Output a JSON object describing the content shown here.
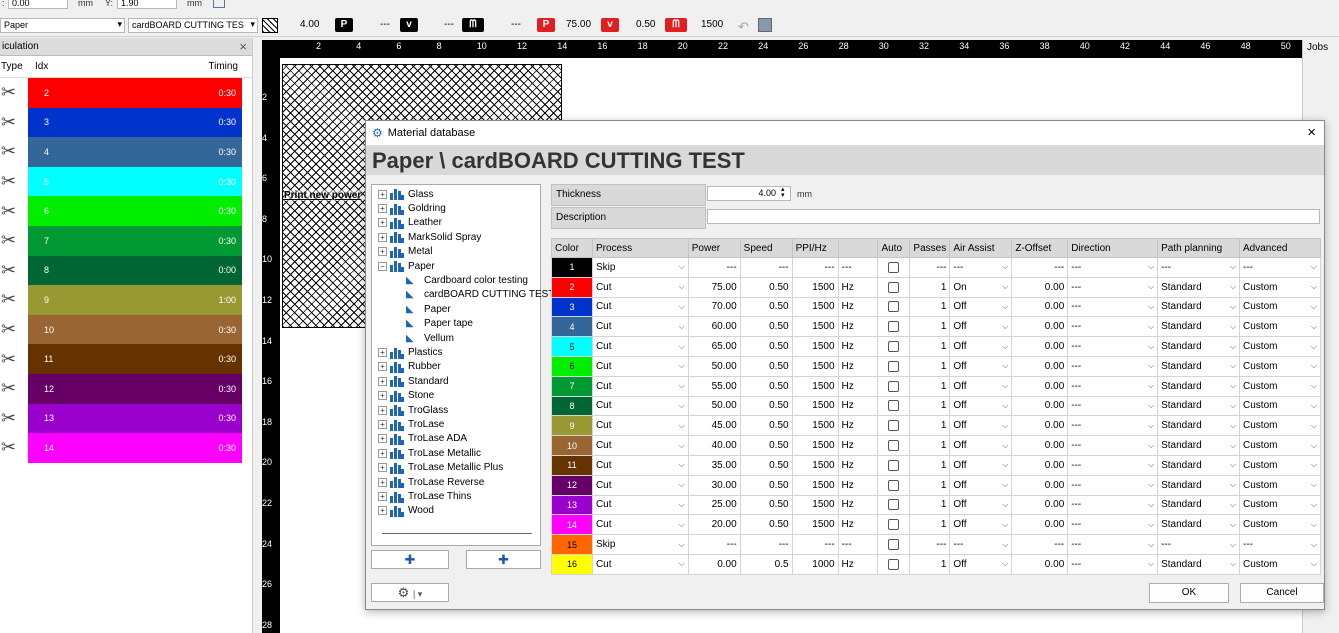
{
  "toolbar_top": {
    "x_value": "0.00",
    "x_unit": "mm",
    "y_label": "Y:",
    "y_value": "1.90",
    "y_unit": "mm"
  },
  "toolbar": {
    "material_group": "Paper",
    "material_name": "cardBOARD CUTTING TES",
    "thickness": "4.00",
    "p_label": "P",
    "p_value": "---",
    "v_label": "v",
    "v_value": "---",
    "hz_value": "---",
    "active_power": "75.00",
    "active_speed": "0.50",
    "active_freq": "1500"
  },
  "left_panel": {
    "title": "iculation",
    "close": "×",
    "col_type": "Type",
    "col_idx": "Idx",
    "col_timing": "Timing",
    "rows": [
      {
        "idx": "2",
        "timing": "0:30",
        "color": "#ff0000"
      },
      {
        "idx": "3",
        "timing": "0:30",
        "color": "#0033cc"
      },
      {
        "idx": "4",
        "timing": "0:30",
        "color": "#336699"
      },
      {
        "idx": "5",
        "timing": "0:30",
        "color": "#00ffff"
      },
      {
        "idx": "6",
        "timing": "0:30",
        "color": "#00ee00"
      },
      {
        "idx": "7",
        "timing": "0:30",
        "color": "#009933"
      },
      {
        "idx": "8",
        "timing": "0:00",
        "color": "#006633"
      },
      {
        "idx": "9",
        "timing": "1:00",
        "color": "#999933"
      },
      {
        "idx": "10",
        "timing": "0:30",
        "color": "#996633"
      },
      {
        "idx": "11",
        "timing": "0:30",
        "color": "#663300"
      },
      {
        "idx": "12",
        "timing": "0:30",
        "color": "#660066"
      },
      {
        "idx": "13",
        "timing": "0:30",
        "color": "#9900cc"
      },
      {
        "idx": "14",
        "timing": "0:30",
        "color": "#ff00ff"
      }
    ]
  },
  "ruler": {
    "top": [
      "2",
      "4",
      "6",
      "8",
      "10",
      "12",
      "14",
      "16",
      "18",
      "20",
      "22",
      "24",
      "26",
      "28",
      "30",
      "32",
      "34",
      "36",
      "38",
      "40",
      "42",
      "44",
      "46",
      "48",
      "50"
    ],
    "left": [
      "2",
      "4",
      "6",
      "8",
      "10",
      "12",
      "14",
      "16",
      "18",
      "20",
      "22",
      "24",
      "26",
      "28"
    ]
  },
  "canvas": {
    "overlay_text": "Print new power"
  },
  "jobs_tab": "Jobs",
  "dialog": {
    "title": "Material database",
    "heading": "Paper \\ cardBOARD CUTTING TEST",
    "close": "×",
    "tree": [
      {
        "label": "Glass",
        "level": 0,
        "expander": "+"
      },
      {
        "label": "Goldring",
        "level": 0,
        "expander": "+"
      },
      {
        "label": "Leather",
        "level": 0,
        "expander": "+"
      },
      {
        "label": "MarkSolid Spray",
        "level": 0,
        "expander": "+"
      },
      {
        "label": "Metal",
        "level": 0,
        "expander": "+"
      },
      {
        "label": "Paper",
        "level": 0,
        "expander": "−"
      },
      {
        "label": "Cardboard color testing",
        "level": 1
      },
      {
        "label": "cardBOARD CUTTING TEST",
        "level": 1
      },
      {
        "label": "Paper",
        "level": 1
      },
      {
        "label": "Paper tape",
        "level": 1
      },
      {
        "label": "Vellum",
        "level": 1
      },
      {
        "label": "Plastics",
        "level": 0,
        "expander": "+"
      },
      {
        "label": "Rubber",
        "level": 0,
        "expander": "+"
      },
      {
        "label": "Standard",
        "level": 0,
        "expander": "+"
      },
      {
        "label": "Stone",
        "level": 0,
        "expander": "+"
      },
      {
        "label": "TroGlass",
        "level": 0,
        "expander": "+"
      },
      {
        "label": "TroLase",
        "level": 0,
        "expander": "+"
      },
      {
        "label": "TroLase ADA",
        "level": 0,
        "expander": "+"
      },
      {
        "label": "TroLase Metallic",
        "level": 0,
        "expander": "+"
      },
      {
        "label": "TroLase Metallic Plus",
        "level": 0,
        "expander": "+"
      },
      {
        "label": "TroLase Reverse",
        "level": 0,
        "expander": "+"
      },
      {
        "label": "TroLase Thins",
        "level": 0,
        "expander": "+"
      },
      {
        "label": "Wood",
        "level": 0,
        "expander": "+"
      }
    ],
    "thickness_label": "Thickness",
    "thickness_value": "4.00",
    "thickness_unit": "mm",
    "description_label": "Description",
    "description_value": "",
    "columns": [
      "Color",
      "Process",
      "Power",
      "Speed",
      "PPI/Hz",
      "",
      "Auto",
      "Passes",
      "Air Assist",
      "Z-Offset",
      "Direction",
      "Path planning",
      "Advanced"
    ],
    "rows": [
      {
        "idx": "1",
        "color": "#000000",
        "process": "Skip",
        "power": "---",
        "speed": "---",
        "ppi": "---",
        "unit": "---",
        "passes": "---",
        "air": "---",
        "z": "---",
        "dir": "---",
        "path": "---",
        "adv": "---"
      },
      {
        "idx": "2",
        "color": "#ff0000",
        "process": "Cut",
        "power": "75.00",
        "speed": "0.50",
        "ppi": "1500",
        "unit": "Hz",
        "passes": "1",
        "air": "On",
        "z": "0.00",
        "dir": "---",
        "path": "Standard",
        "adv": "Custom"
      },
      {
        "idx": "3",
        "color": "#0033cc",
        "process": "Cut",
        "power": "70.00",
        "speed": "0.50",
        "ppi": "1500",
        "unit": "Hz",
        "passes": "1",
        "air": "Off",
        "z": "0.00",
        "dir": "---",
        "path": "Standard",
        "adv": "Custom"
      },
      {
        "idx": "4",
        "color": "#336699",
        "process": "Cut",
        "power": "60.00",
        "speed": "0.50",
        "ppi": "1500",
        "unit": "Hz",
        "passes": "1",
        "air": "Off",
        "z": "0.00",
        "dir": "---",
        "path": "Standard",
        "adv": "Custom"
      },
      {
        "idx": "5",
        "color": "#00ffff",
        "process": "Cut",
        "power": "65.00",
        "speed": "0.50",
        "ppi": "1500",
        "unit": "Hz",
        "passes": "1",
        "air": "Off",
        "z": "0.00",
        "dir": "---",
        "path": "Standard",
        "adv": "Custom"
      },
      {
        "idx": "6",
        "color": "#00ee00",
        "process": "Cut",
        "power": "50.00",
        "speed": "0.50",
        "ppi": "1500",
        "unit": "Hz",
        "passes": "1",
        "air": "Off",
        "z": "0.00",
        "dir": "---",
        "path": "Standard",
        "adv": "Custom"
      },
      {
        "idx": "7",
        "color": "#009933",
        "process": "Cut",
        "power": "55.00",
        "speed": "0.50",
        "ppi": "1500",
        "unit": "Hz",
        "passes": "1",
        "air": "Off",
        "z": "0.00",
        "dir": "---",
        "path": "Standard",
        "adv": "Custom"
      },
      {
        "idx": "8",
        "color": "#006633",
        "process": "Cut",
        "power": "50.00",
        "speed": "0.50",
        "ppi": "1500",
        "unit": "Hz",
        "passes": "1",
        "air": "Off",
        "z": "0.00",
        "dir": "---",
        "path": "Standard",
        "adv": "Custom"
      },
      {
        "idx": "9",
        "color": "#999933",
        "process": "Cut",
        "power": "45.00",
        "speed": "0.50",
        "ppi": "1500",
        "unit": "Hz",
        "passes": "1",
        "air": "Off",
        "z": "0.00",
        "dir": "---",
        "path": "Standard",
        "adv": "Custom"
      },
      {
        "idx": "10",
        "color": "#996633",
        "process": "Cut",
        "power": "40.00",
        "speed": "0.50",
        "ppi": "1500",
        "unit": "Hz",
        "passes": "1",
        "air": "Off",
        "z": "0.00",
        "dir": "---",
        "path": "Standard",
        "adv": "Custom"
      },
      {
        "idx": "11",
        "color": "#663300",
        "process": "Cut",
        "power": "35.00",
        "speed": "0.50",
        "ppi": "1500",
        "unit": "Hz",
        "passes": "1",
        "air": "Off",
        "z": "0.00",
        "dir": "---",
        "path": "Standard",
        "adv": "Custom"
      },
      {
        "idx": "12",
        "color": "#660066",
        "process": "Cut",
        "power": "30.00",
        "speed": "0.50",
        "ppi": "1500",
        "unit": "Hz",
        "passes": "1",
        "air": "Off",
        "z": "0.00",
        "dir": "---",
        "path": "Standard",
        "adv": "Custom"
      },
      {
        "idx": "13",
        "color": "#9900cc",
        "process": "Cut",
        "power": "25.00",
        "speed": "0.50",
        "ppi": "1500",
        "unit": "Hz",
        "passes": "1",
        "air": "Off",
        "z": "0.00",
        "dir": "---",
        "path": "Standard",
        "adv": "Custom"
      },
      {
        "idx": "14",
        "color": "#ff00ff",
        "process": "Cut",
        "power": "20.00",
        "speed": "0.50",
        "ppi": "1500",
        "unit": "Hz",
        "passes": "1",
        "air": "Off",
        "z": "0.00",
        "dir": "---",
        "path": "Standard",
        "adv": "Custom"
      },
      {
        "idx": "15",
        "color": "#ff6600",
        "process": "Skip",
        "power": "---",
        "speed": "---",
        "ppi": "---",
        "unit": "---",
        "passes": "---",
        "air": "---",
        "z": "---",
        "dir": "---",
        "path": "---",
        "adv": "---"
      },
      {
        "idx": "16",
        "color": "#ffff00",
        "process": "Cut",
        "power": "0.00",
        "speed": "0.5",
        "ppi": "1000",
        "unit": "Hz",
        "passes": "1",
        "air": "Off",
        "z": "0.00",
        "dir": "---",
        "path": "Standard",
        "adv": "Custom"
      }
    ],
    "ok_label": "OK",
    "cancel_label": "Cancel"
  }
}
